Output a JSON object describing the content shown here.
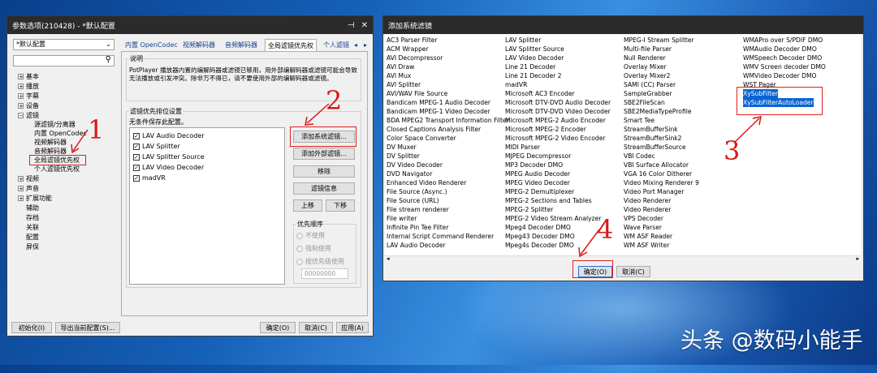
{
  "left_window": {
    "title": "参数选项(210428) - *默认配置",
    "profile": "*默认配置",
    "tree": [
      "基本",
      "播放",
      "字幕",
      "设备",
      "滤镜",
      "源滤镜/分离器",
      "内置 OpenCodec",
      "视频解码器",
      "音频解码器",
      "全局滤镜优先权",
      "个人滤镜优先权",
      "视频",
      "声音",
      "扩展功能",
      "辅助",
      "存档",
      "关联",
      "配置",
      "屏保"
    ],
    "tabs": [
      "内置 OpenCodec",
      "视频解码器",
      "音频解码器",
      "全局滤镜优先权",
      "个人滤镜"
    ],
    "desc_title": "说明",
    "desc_text": "PotPlayer 播放器内置的编解码器或滤镜已够用，用外部编解码器或滤镜可能会导致无法播放或引发冲突。除非万不得已，请不要使用外部的编解码器或滤镜。",
    "filter_group_title": "滤镜优先排位设置",
    "filter_group_sub": "无条件保存此配置。",
    "filters": [
      "LAV Audio Decoder",
      "LAV Splitter",
      "LAV Splitter Source",
      "LAV Video Decoder",
      "madVR"
    ],
    "buttons": {
      "add_system": "添加系统滤镜...",
      "add_external": "添加外部滤镜...",
      "remove": "移除",
      "info": "滤镜信息",
      "up": "上移",
      "down": "下移"
    },
    "priority_title": "优先顺序",
    "priority_options": [
      "不使用",
      "强制使用",
      "按优先级使用"
    ],
    "priority_value": "00000000",
    "bottom": {
      "init": "初始化(I)",
      "export": "导出当前配置(S)...",
      "ok": "确定(O)",
      "cancel": "取消(C)",
      "apply": "应用(A)"
    }
  },
  "right_window": {
    "title": "添加系统滤镜",
    "columns": [
      [
        "AC3 Parser Filter",
        "ACM Wrapper",
        "AVI Decompressor",
        "AVI Draw",
        "AVI Mux",
        "AVI Splitter",
        "AVI/WAV File Source",
        "Bandicam MPEG-1 Audio Decoder",
        "Bandicam MPEG-1 Video Decoder",
        "BDA MPEG2 Transport Information Filter",
        "Closed Captions Analysis Filter",
        "Color Space Converter",
        "DV Muxer",
        "DV Splitter",
        "DV Video Decoder",
        "DVD Navigator",
        "Enhanced Video Renderer",
        "File Source (Async.)",
        "File Source (URL)",
        "File stream renderer",
        "File writer",
        "Infinite Pin Tee Filter",
        "Internal Script Command Renderer",
        "LAV Audio Decoder"
      ],
      [
        "LAV Splitter",
        "LAV Splitter Source",
        "LAV Video Decoder",
        "Line 21 Decoder",
        "Line 21 Decoder 2",
        "madVR",
        "Microsoft AC3 Encoder",
        "Microsoft DTV-DVD Audio Decoder",
        "Microsoft DTV-DVD Video Decoder",
        "Microsoft MPEG-2 Audio Encoder",
        "Microsoft MPEG-2 Encoder",
        "Microsoft MPEG-2 Video Encoder",
        "MIDI Parser",
        "MJPEG Decompressor",
        "MP3 Decoder DMO",
        "MPEG Audio Decoder",
        "MPEG Video Decoder",
        "MPEG-2 Demultiplexer",
        "MPEG-2 Sections and Tables",
        "MPEG-2 Splitter",
        "MPEG-2 Video Stream Analyzer",
        "Mpeg4 Decoder DMO",
        "Mpeg43 Decoder DMO",
        "Mpeg4s Decoder DMO"
      ],
      [
        "MPEG-I Stream Splitter",
        "Multi-file Parser",
        "Null Renderer",
        "Overlay Mixer",
        "Overlay Mixer2",
        "SAMI (CC) Parser",
        "SampleGrabber",
        "SBE2FileScan",
        "SBE2MediaTypeProfile",
        "Smart Tee",
        "StreamBufferSink",
        "StreamBufferSink2",
        "StreamBufferSource",
        "VBI Codec",
        "VBI Surface Allocator",
        "VGA 16 Color Ditherer",
        "Video Mixing Renderer 9",
        "Video Port Manager",
        "Video Renderer",
        "Video Renderer",
        "VPS Decoder",
        "Wave Parser",
        "WM ASF Reader",
        "WM ASF Writer"
      ],
      [
        "WMAPro over S/PDIF DMO",
        "WMAudio Decoder DMO",
        "WMSpeech Decoder DMO",
        "WMV Screen decoder DMO",
        "WMVideo Decoder DMO",
        "WST Pager",
        "XySubFilter",
        "XySubFilterAutoLoader"
      ]
    ],
    "ok": "确定(O)",
    "cancel": "取消(C)"
  },
  "annotations": [
    "1",
    "2",
    "3",
    "4"
  ],
  "watermark": "头条 @数码小能手"
}
